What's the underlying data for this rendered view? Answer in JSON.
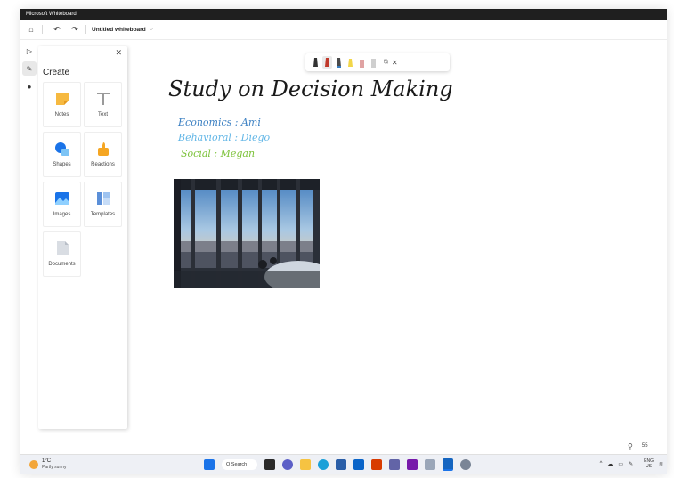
{
  "window": {
    "title": "Microsoft Whiteboard"
  },
  "appbar": {
    "board_title": "Untitled whiteboard"
  },
  "create_panel": {
    "heading": "Create",
    "items": [
      {
        "label": "Notes",
        "icon": "sticky-note-icon"
      },
      {
        "label": "Text",
        "icon": "text-icon"
      },
      {
        "label": "Shapes",
        "icon": "shapes-icon"
      },
      {
        "label": "Reactions",
        "icon": "thumbs-up-icon"
      },
      {
        "label": "Images",
        "icon": "image-icon"
      },
      {
        "label": "Templates",
        "icon": "template-icon"
      },
      {
        "label": "Documents",
        "icon": "document-icon"
      }
    ]
  },
  "canvas": {
    "heading_ink": "Study on Decision Making",
    "ink_lines": [
      "Economics : Ami",
      "Behavioral : Diego",
      "Social : Megan"
    ]
  },
  "zoom": {
    "value": "55"
  },
  "taskbar": {
    "weather_temp": "1°C",
    "weather_desc": "Partly sunny",
    "search_label": "Q Search",
    "lang_top": "ENG",
    "lang_bottom": "US"
  },
  "colors": {
    "ink_black": "#1a1a1a",
    "ink_blue": "#3a7fc2",
    "ink_lightblue": "#62b6e6",
    "ink_green": "#7cc23a",
    "accent_orange": "#f4a23a"
  }
}
